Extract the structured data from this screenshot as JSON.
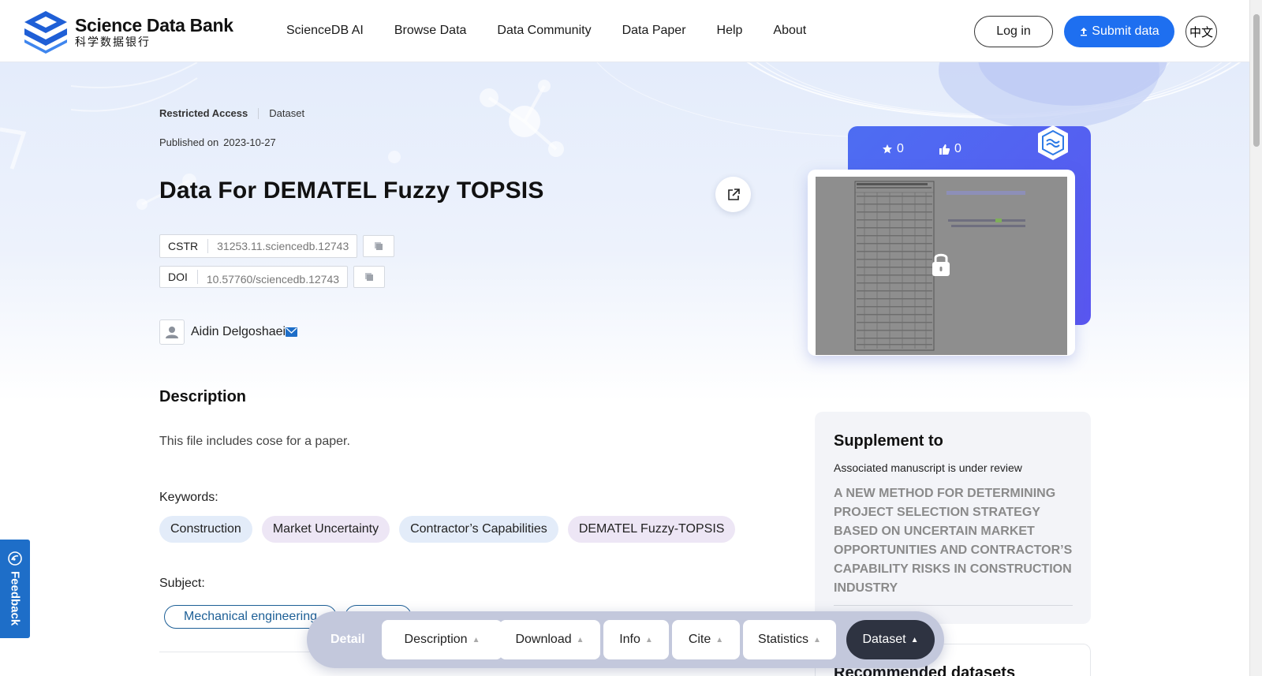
{
  "header": {
    "logo_en": "Science Data Bank",
    "logo_zh": "科学数据银行",
    "nav": [
      "ScienceDB AI",
      "Browse Data",
      "Data Community",
      "Data Paper",
      "Help",
      "About"
    ],
    "login_label": "Log in",
    "submit_label": "Submit data",
    "lang_label": "中文"
  },
  "dataset": {
    "access": "Restricted Access",
    "type": "Dataset",
    "published_label": "Published on",
    "published_date": "2023-10-27",
    "title": "Data For DEMATEL Fuzzy TOPSIS",
    "cstr_label": "CSTR",
    "cstr_value": "31253.11.sciencedb.12743",
    "doi_label": "DOI",
    "doi_value": "10.57760/sciencedb.12743",
    "author": "Aidin Delgoshaei"
  },
  "description": {
    "heading": "Description",
    "text": "This file includes cose for a paper.",
    "keywords_label": "Keywords:",
    "keywords": [
      "Construction",
      "Market Uncertainty",
      "Contractor’s Capabilities",
      "DEMATEL Fuzzy-TOPSIS"
    ],
    "subject_label": "Subject:",
    "subjects": [
      "Mechanical engineering"
    ]
  },
  "sidebar": {
    "stars": "0",
    "likes": "0",
    "supplement_title": "Supplement to",
    "supplement_status": "Associated manuscript is under review",
    "supplement_paper": "A NEW METHOD FOR DETERMINING PROJECT SELECTION STRATEGY BASED ON UNCERTAIN MARKET OPPORTUNITIES AND CONTRACTOR’S CAPABILITY RISKS IN CONSTRUCTION INDUSTRY",
    "recommended_title": "Recommended datasets"
  },
  "feedback_label": "Feedback",
  "tabbar": {
    "detail": "Detail",
    "tabs": [
      "Description",
      "Download",
      "Info",
      "Cite",
      "Statistics",
      "Dataset"
    ],
    "active": "Dataset"
  },
  "colors": {
    "primary": "#1e6ff0",
    "card_gradient_start": "#4d6df2",
    "feedback": "#1e6ec8",
    "tab_active": "#2e3341",
    "subject_border": "#1d5f96"
  }
}
